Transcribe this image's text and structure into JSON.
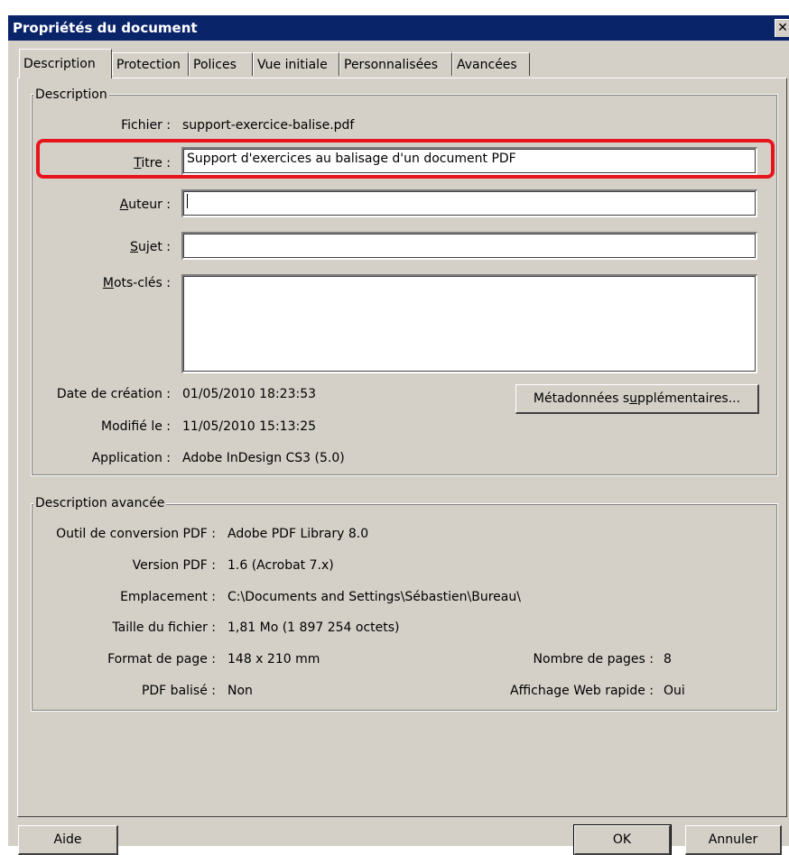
{
  "window": {
    "title": "Propriétés du document",
    "close_label": "✕"
  },
  "tabs": [
    {
      "label": "Description"
    },
    {
      "label": "Protection"
    },
    {
      "label": "Polices"
    },
    {
      "label": "Vue initiale"
    },
    {
      "label": "Personnalisées"
    },
    {
      "label": "Avancées"
    }
  ],
  "description": {
    "group_label": "Description",
    "fichier_label": "Fichier :",
    "fichier_value": "support-exercice-balise.pdf",
    "titre_label_accel": "T",
    "titre_label_rest": "itre :",
    "titre_value": "Support d'exercices au balisage d'un document PDF",
    "auteur_label_accel": "A",
    "auteur_label_rest": "uteur :",
    "auteur_value": "",
    "sujet_label_accel": "S",
    "sujet_label_rest": "ujet :",
    "sujet_value": "",
    "motscles_label_accel": "M",
    "motscles_label_rest": "ots-clés :",
    "motscles_value": "",
    "creation_label": "Date de création :",
    "creation_value": "01/05/2010 18:23:53",
    "modifie_label": "Modifié le :",
    "modifie_value": "11/05/2010 15:13:25",
    "application_label": "Application :",
    "application_value": "Adobe InDesign CS3 (5.0)",
    "meta_button_pre": "Métadonnées s",
    "meta_button_accel": "u",
    "meta_button_post": "pplémentaires..."
  },
  "advanced": {
    "group_label": "Description avancée",
    "conversion_label": "Outil de conversion PDF :",
    "conversion_value": "Adobe PDF Library 8.0",
    "version_label": "Version PDF :",
    "version_value": "1.6 (Acrobat 7.x)",
    "emplacement_label": "Emplacement :",
    "emplacement_value": "C:\\Documents and Settings\\Sébastien\\Bureau\\",
    "taille_label": "Taille du fichier :",
    "taille_value": "1,81 Mo (1 897 254 octets)",
    "format_label": "Format de page :",
    "format_value": "148 x 210 mm",
    "pages_label": "Nombre de pages :",
    "pages_value": "8",
    "balise_label": "PDF balisé :",
    "balise_value": "Non",
    "web_label": "Affichage Web rapide :",
    "web_value": "Oui"
  },
  "buttons": {
    "help": "Aide",
    "ok": "OK",
    "cancel": "Annuler"
  },
  "colors": {
    "title_bar": "#0a246a",
    "highlight": "#e8141c",
    "face": "#d4d0c8"
  }
}
